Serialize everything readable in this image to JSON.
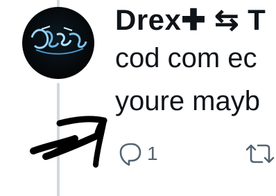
{
  "tweet": {
    "author": {
      "display_name": "Drex✚ ⇆ T"
    },
    "text_lines": [
      "cod com ec",
      "youre mayb"
    ],
    "actions": {
      "reply": {
        "icon": "reply-icon",
        "count": "1"
      },
      "retweet": {
        "icon": "retweet-icon"
      }
    }
  },
  "colors": {
    "text": "#0f1419",
    "secondary": "#536471",
    "thread_line": "#cfd9de",
    "annotation": "#000000"
  }
}
